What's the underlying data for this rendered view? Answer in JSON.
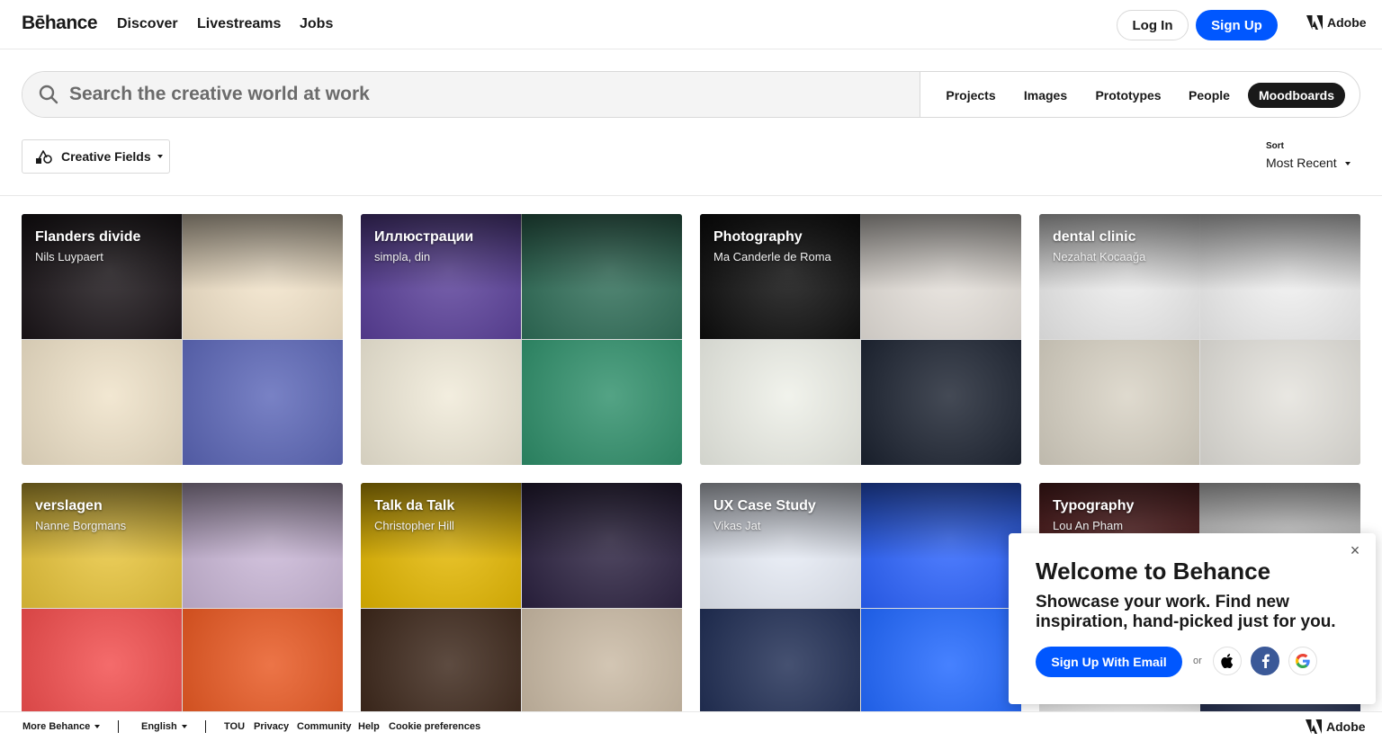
{
  "header": {
    "logo": "Bēhance",
    "nav": [
      "Discover",
      "Livestreams",
      "Jobs"
    ],
    "login": "Log In",
    "signup": "Sign Up",
    "adobe": "Adobe"
  },
  "search": {
    "placeholder": "Search the creative world at work",
    "tabs": [
      "Projects",
      "Images",
      "Prototypes",
      "People",
      "Moodboards"
    ],
    "active_tab": "Moodboards"
  },
  "filters": {
    "creative_fields": "Creative Fields",
    "sort_label": "Sort",
    "sort_value": "Most Recent"
  },
  "moodboards": [
    {
      "title": "Flanders divide",
      "owner": "Nils Luypaert",
      "colors": [
        "#1a1418",
        "#f5e6cc",
        "#efe2c8",
        "#5b66b8"
      ]
    },
    {
      "title": "Иллюстрации",
      "owner": "simpla, din",
      "colors": [
        "#5a3f9a",
        "#2f6e58",
        "#f0ead8",
        "#2e8f6a"
      ]
    },
    {
      "title": "Photography",
      "owner": "Ma Canderle de Roma",
      "colors": [
        "#0d0d0d",
        "#e7e2dc",
        "#eef0e8",
        "#1b2230"
      ]
    },
    {
      "title": "dental clinic",
      "owner": "Nezahat Kocaağa",
      "colors": [
        "#eeeeee",
        "#f2f2f2",
        "#d8d2c4",
        "#e4e2dc"
      ]
    },
    {
      "title": "verslagen",
      "owner": "Nanne Borgmans",
      "colors": [
        "#e9c53a",
        "#cbb8d8",
        "#f24b4b",
        "#e8561f"
      ]
    },
    {
      "title": "Talk da Talk",
      "owner": "Christopher Hill",
      "colors": [
        "#e5b800",
        "#2b2140",
        "#3a2417",
        "#c9b9a3"
      ]
    },
    {
      "title": "UX Case Study",
      "owner": "Vikas Jat",
      "colors": [
        "#e9eef8",
        "#2b63ff",
        "#1d2b52",
        "#1e66ff"
      ]
    },
    {
      "title": "Typography",
      "owner": "Lou An Pham",
      "colors": [
        "#5a1f20",
        "#efefef",
        "#f0f0f0",
        "#202a4a"
      ]
    }
  ],
  "popup": {
    "title": "Welcome to Behance",
    "body": "Showcase your work. Find new inspiration, hand-picked just for you.",
    "email_button": "Sign Up With Email",
    "or": "or",
    "close": "×"
  },
  "footer": {
    "more": "More Behance",
    "language": "English",
    "links": [
      "TOU",
      "Privacy",
      "Community",
      "Help",
      "Cookie preferences"
    ],
    "adobe": "Adobe"
  }
}
